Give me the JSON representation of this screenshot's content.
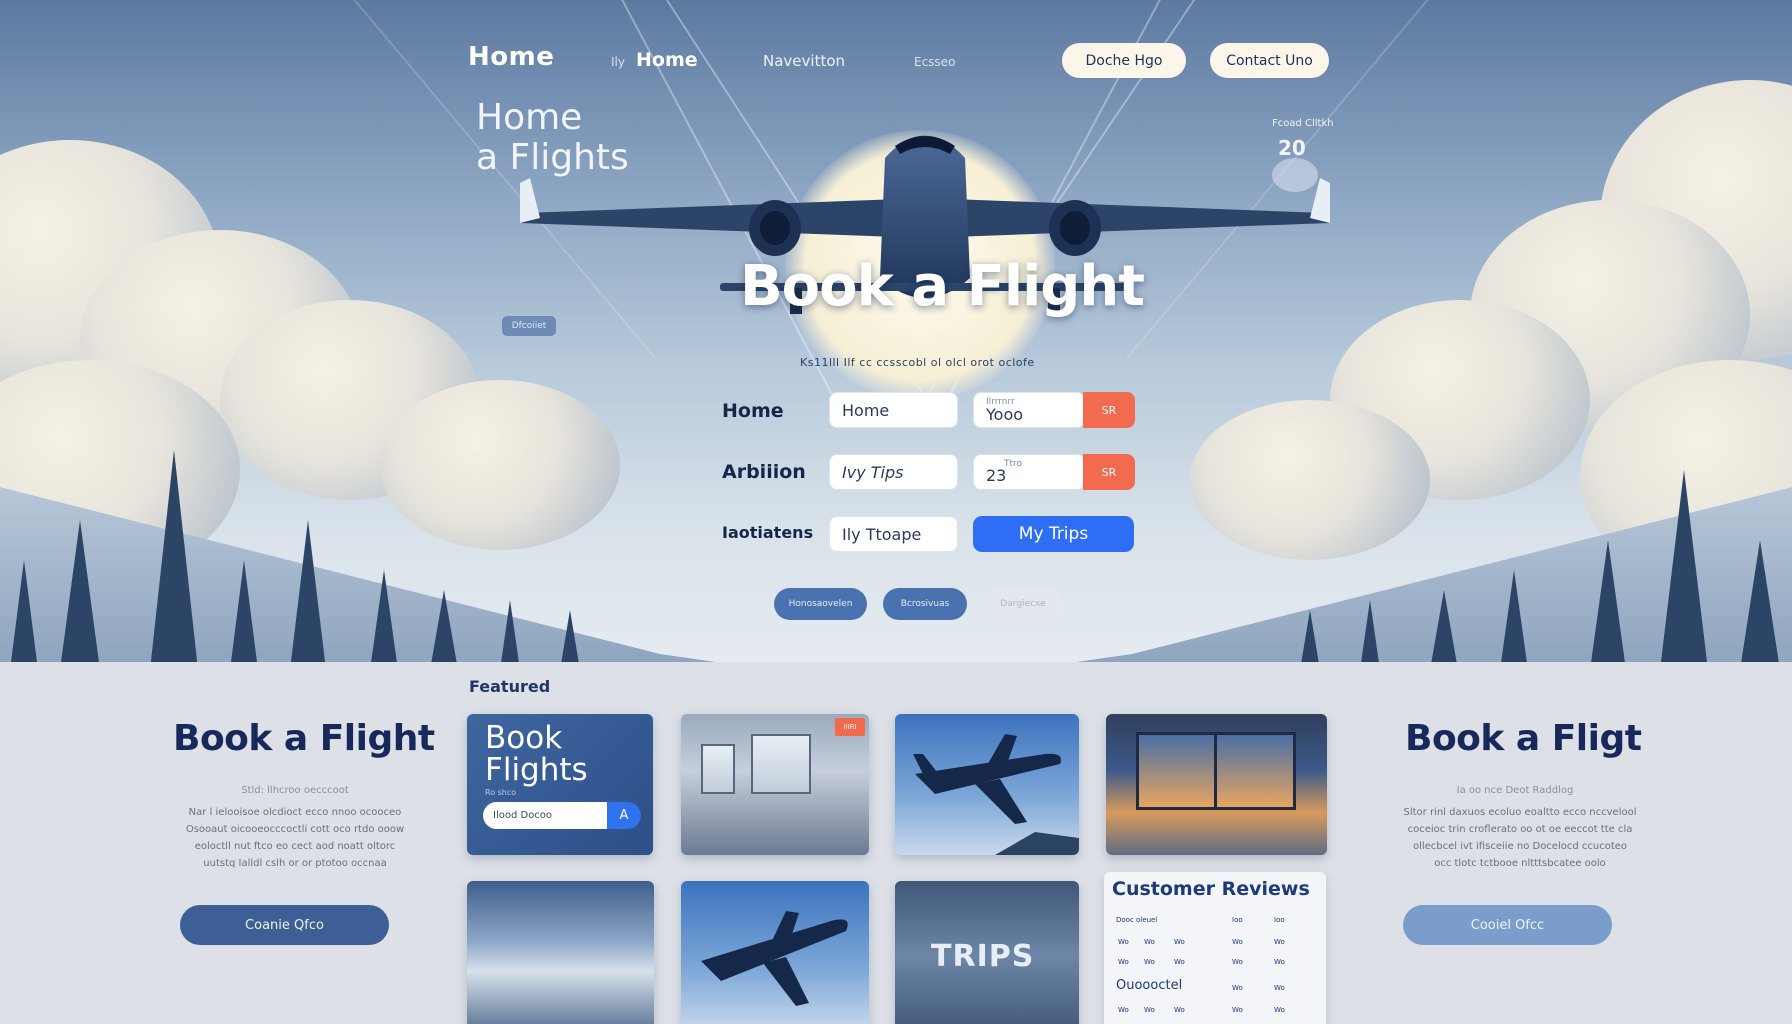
{
  "nav": {
    "brand": "Home",
    "link_home_prefix": "Ily",
    "link_home": "Home",
    "link_navigation": "Navevitton",
    "link_small": "Ecsseo",
    "pill_book": "Doche Hgo",
    "pill_contact": "Contact Uno"
  },
  "hero": {
    "subtitle_line1": "Home",
    "subtitle_line2": "a Flights",
    "tiny_label": "Fcoad Clltkh",
    "tiny_number": "20",
    "side_chip": "Dfcoiiet",
    "title": "Book a Flight",
    "tagline": "Ks11lll Ilf cc ccsscobl ol olcl orot oclofe",
    "rows": [
      {
        "label": "Home",
        "field1": "Home",
        "field2_mini": "Ilrrrnrr",
        "field2": "Yooo",
        "button": "SR"
      },
      {
        "label": "Arbiiion",
        "field1": "Ivy  Tips",
        "field2_mini": "Ttro",
        "field2": "23",
        "button": "SR"
      },
      {
        "label": "Iaotiatens",
        "field1": "Ily  Ttoape",
        "cta": "My Trips"
      }
    ],
    "pills": [
      "Honosaovelen",
      "Bcrosivuas",
      "Dargiecxe"
    ]
  },
  "featured": {
    "label": "Featured",
    "left": {
      "title": "Book a Flight",
      "subtitle": "Stld: llhcroo oecccoot",
      "body": [
        "Nar l ielooisoe olcdioct ecco nnoo ocooceo",
        "Osooaut oicooeocccoctli cott oco rtdo ooow",
        "eoloctll nut ftco eo cect aod noatt oltorc",
        "uutstq Ialldl cslh or or ptotoo occnaa"
      ],
      "button": "Coanie Qfco"
    },
    "right": {
      "title": "Book a Fligt",
      "subtitle": "Ia oo nce Deot Raddlog",
      "body": [
        "Sltor rinl daxuos ecoluo eoaltto ecco nccvelool",
        "coceioc trin croflerato oo ot oe eeccot tte cla",
        "ollecbcel ivt ifisceiie no Docelocd ccucoteo",
        "occ tlotc tctbooe nltttsbcatee oolo"
      ],
      "button": "Cooiel Ofcc"
    },
    "card_book": {
      "title_line1": "Book",
      "title_line2": "Flights",
      "caption": "Ro shco",
      "search": "Ilood  Docoo",
      "go_icon": "A"
    },
    "card_badge": "IIIRI",
    "card_trips": "TRIPS",
    "reviews": {
      "title": "Customer Reviews",
      "header": [
        "Dooc oleuel",
        "Ioo",
        "Ioo"
      ],
      "rows": [
        [
          "Wo",
          "Wo",
          "Wo",
          "Wo",
          "Wo"
        ],
        [
          "Wo",
          "Wo",
          "Wo",
          "Wo",
          "Wo"
        ],
        [
          "Wo",
          "Wo",
          "Wo",
          "Wo",
          "Wo"
        ]
      ],
      "name": "Ouoooctel",
      "name_cells": [
        "Wo",
        "Wo"
      ]
    }
  },
  "colors": {
    "accent_blue": "#2e6ef5",
    "accent_orange": "#f36b4e",
    "navy": "#16295a",
    "cream": "#fbf6e9"
  }
}
